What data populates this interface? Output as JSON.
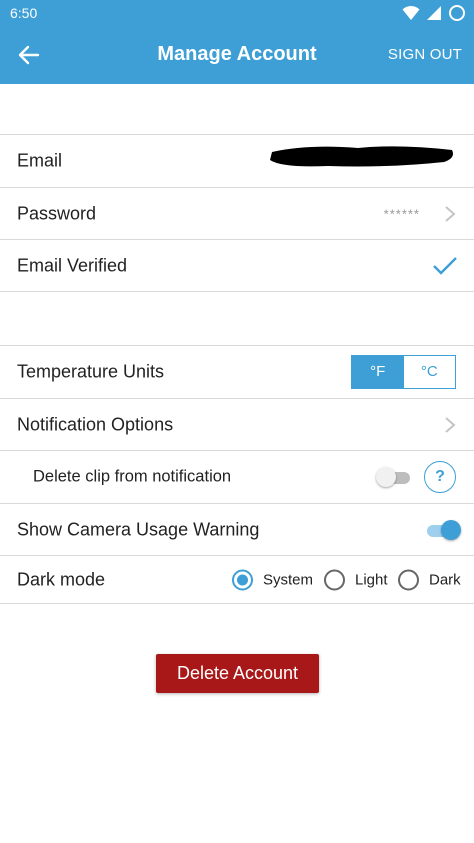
{
  "statusbar": {
    "time": "6:50",
    "wifi_icon": "wifi-icon",
    "signal_icon": "signal-icon",
    "battery_icon": "battery-icon"
  },
  "appbar": {
    "title": "Manage Account",
    "sign_out": "SIGN OUT",
    "back_icon": "arrow-back-icon"
  },
  "colors": {
    "primary": "#3d9fd6",
    "danger": "#a81818",
    "divider": "#d9d9d9"
  },
  "account": {
    "email_label": "Email",
    "password_label": "Password",
    "password_value": "******",
    "email_verified_label": "Email Verified"
  },
  "settings": {
    "temperature_label": "Temperature Units",
    "temp_f": "°F",
    "temp_c": "°C",
    "temp_selected": "°F",
    "notification_label": "Notification Options",
    "delete_clip_label": "Delete clip from notification",
    "delete_clip_enabled": false,
    "help_label": "?",
    "camera_warning_label": "Show Camera Usage Warning",
    "camera_warning_enabled": true,
    "dark_mode_label": "Dark mode",
    "dark_mode_options": [
      "System",
      "Light",
      "Dark"
    ],
    "dark_mode_selected": "System"
  },
  "delete_account": "Delete Account"
}
